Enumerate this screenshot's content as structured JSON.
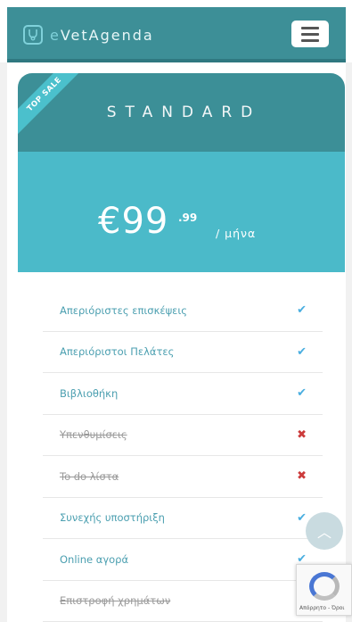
{
  "app": {
    "brand_prefix": "e",
    "brand_name": "VetAgenda",
    "icon": "stethoscope-icon"
  },
  "card": {
    "ribbon": "TOP SALE",
    "plan_name": "STANDARD",
    "price_main": "€99",
    "price_cents": ".99",
    "price_period": "/ μήνα"
  },
  "features": [
    {
      "label": "Απεριόριστες επισκέψεις",
      "included": true,
      "mark": "✔"
    },
    {
      "label": "Απεριόριστοι Πελάτες",
      "included": true,
      "mark": "✔"
    },
    {
      "label": "Βιβλιοθήκη",
      "included": true,
      "mark": "✔"
    },
    {
      "label": "Υπενθυμίσεις",
      "included": false,
      "mark": "✖"
    },
    {
      "label": "To do λίστα",
      "included": false,
      "mark": "✖"
    },
    {
      "label": "Συνεχής υποστήριξη",
      "included": true,
      "mark": "✔"
    },
    {
      "label": "Online αγορά",
      "included": true,
      "mark": "✔"
    },
    {
      "label": "Επιστροφή χρημάτων",
      "included": false,
      "mark": ""
    }
  ],
  "widgets": {
    "scroll_top_icon": "chevron-up-icon",
    "scroll_top_glyph": "︿",
    "recaptcha_text": "Απόρρητο - Όροι"
  },
  "colors": {
    "header": "#3d8f97",
    "price_box": "#4bbac9",
    "feature_text": "#4b9fb0",
    "check": "#49aee0",
    "cross": "#cc3b3b"
  }
}
